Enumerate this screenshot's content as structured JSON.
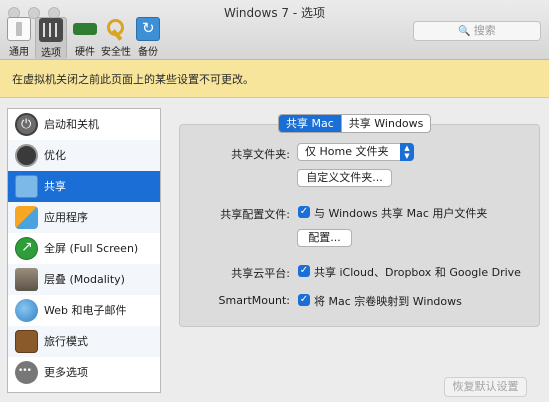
{
  "window": {
    "title": "Windows 7 - 选项"
  },
  "toolbar": {
    "items": [
      {
        "label": "通用",
        "icon": "general-icon"
      },
      {
        "label": "选项",
        "icon": "options-icon"
      },
      {
        "label": "硬件",
        "icon": "hardware-icon"
      },
      {
        "label": "安全性",
        "icon": "security-lock-icon"
      },
      {
        "label": "备份",
        "icon": "backup-icon"
      }
    ],
    "active": "选项"
  },
  "search": {
    "placeholder": "搜索"
  },
  "banner": {
    "text": "在虚拟机关闭之前此页面上的某些设置不可更改。"
  },
  "sidebar": {
    "items": [
      {
        "label": "启动和关机",
        "icon": "power-icon"
      },
      {
        "label": "优化",
        "icon": "optimization-icon"
      },
      {
        "label": "共享",
        "icon": "sharing-icon"
      },
      {
        "label": "应用程序",
        "icon": "applications-icon"
      },
      {
        "label": "全屏 (Full Screen)",
        "icon": "fullscreen-icon"
      },
      {
        "label": "层叠 (Modality)",
        "icon": "modality-icon"
      },
      {
        "label": "Web 和电子邮件",
        "icon": "web-email-icon"
      },
      {
        "label": "旅行模式",
        "icon": "travel-mode-icon"
      },
      {
        "label": "更多选项",
        "icon": "more-options-icon"
      }
    ],
    "selected": "共享"
  },
  "segmented": {
    "share_mac": "共享 Mac",
    "share_windows": "共享 Windows",
    "selected": "共享 Mac"
  },
  "share_folders": {
    "label": "共享文件夹:",
    "value": "仅 Home 文件夹",
    "custom_button": "自定义文件夹..."
  },
  "share_profile": {
    "label": "共享配置文件:",
    "checkbox_label": "与 Windows 共享 Mac 用户文件夹",
    "checked": true,
    "config_button": "配置..."
  },
  "share_cloud": {
    "label": "共享云平台:",
    "checkbox_label": "共享 iCloud、Dropbox 和 Google Drive",
    "checked": true
  },
  "smartmount": {
    "label": "SmartMount:",
    "checkbox_label": "将 Mac 宗卷映射到 Windows",
    "checked": true
  },
  "footer": {
    "restore_defaults": "恢复默认设置"
  },
  "colors": {
    "accent": "#1a6ed6",
    "banner": "#f6e59b"
  }
}
